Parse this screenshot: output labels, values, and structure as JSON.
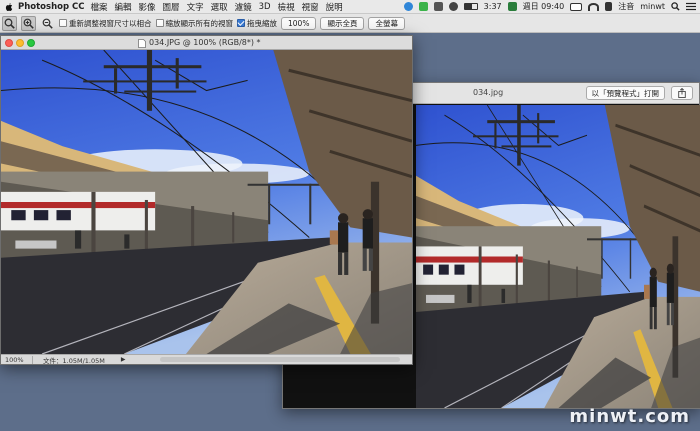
{
  "menubar": {
    "app_name": "Photoshop CC",
    "items": [
      "檔案",
      "編輯",
      "影像",
      "圖層",
      "文字",
      "選取",
      "濾鏡",
      "3D",
      "檢視",
      "視窗",
      "說明"
    ],
    "time": "3:37",
    "date": "週日 09:40",
    "input_label": "注音",
    "user": "minwt"
  },
  "options_bar": {
    "resize_windows_label": "重新調整視窗尺寸以相合",
    "resize_windows_checked": false,
    "zoom_all_windows_label": "縮放顯示所有的視窗",
    "zoom_all_windows_checked": false,
    "scrubby_zoom_label": "拖曳縮放",
    "scrubby_zoom_checked": true,
    "btn_100": "100%",
    "btn_fit": "顯示全頁",
    "btn_fill": "全螢幕"
  },
  "ps_window": {
    "title": "034.JPG @ 100% (RGB/8*) *",
    "zoom": "100%",
    "doc_size": "文件：1.05M/1.05M"
  },
  "preview_window": {
    "title": "034.jpg",
    "open_button": "以「預覽程式」打開"
  },
  "watermark": "minwt.com",
  "colors": {
    "desktop": "#5d6e8a",
    "sky": "#3f63d8",
    "canopy": "#6b5a48",
    "platform": "#9a9288",
    "tracks": "#2d2d33"
  }
}
